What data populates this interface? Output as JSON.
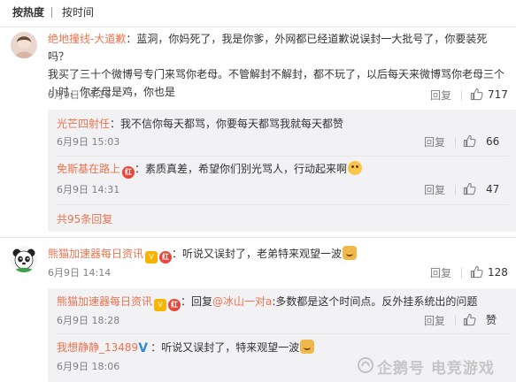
{
  "tabs": {
    "hot": "按热度",
    "time": "按时间"
  },
  "comments": [
    {
      "user": "绝地撞线-大道歉",
      "text_line1": "：蓝洞，你妈死了，我是你爹，外网都已经道歉说误封一大批号了，你要装死吗？",
      "text_line2": "我买了三十个微博号专门来骂你老母。不管解封不解封，都不玩了，以后每天来微博骂你老母三个",
      "text_line3": "小时，你老母是鸡，你也是",
      "date": "6月9日 14:16",
      "reply": "回复",
      "likes": "717",
      "replies": [
        {
          "user": "光芒四射任",
          "text": "：我不信你每天都骂，你要每天都骂我就每天都赞",
          "date": "6月9日 15:03",
          "reply": "回复",
          "likes": "66"
        },
        {
          "user": "免斯基在路上",
          "badge": "红",
          "text": "：素质真差，希望你们别光骂人，行动起来啊",
          "date": "6月9日 14:31",
          "reply": "回复",
          "likes": "47"
        }
      ],
      "more": "共95条回复"
    },
    {
      "user": "熊猫加速器每日资讯",
      "vip": "V",
      "badge": "红",
      "text": "：听说又误封了，老弟特来观望一波",
      "date": "6月9日 14:14",
      "reply": "回复",
      "likes": "128",
      "replies": [
        {
          "user": "熊猫加速器每日资讯",
          "vip": "V",
          "badge": "红",
          "pre": "：回复",
          "mention": "@冰山一对a",
          "text": ":多数都是这个时间点。反外挂系统出的问题",
          "date": "6月9日 18:28",
          "reply": "回复",
          "likes": "赞"
        },
        {
          "user": "我想静静_13489",
          "v": "V",
          "text": "：听说又误封了，特来观望一波",
          "date": "6月9日 18:06",
          "reply": "回复",
          "likes": ""
        }
      ]
    }
  ],
  "watermark": "企鹅号 电竞游戏",
  "colors": {
    "accent": "#eb7350",
    "meta": "#808080",
    "sub_bg": "#f2f2f5"
  }
}
